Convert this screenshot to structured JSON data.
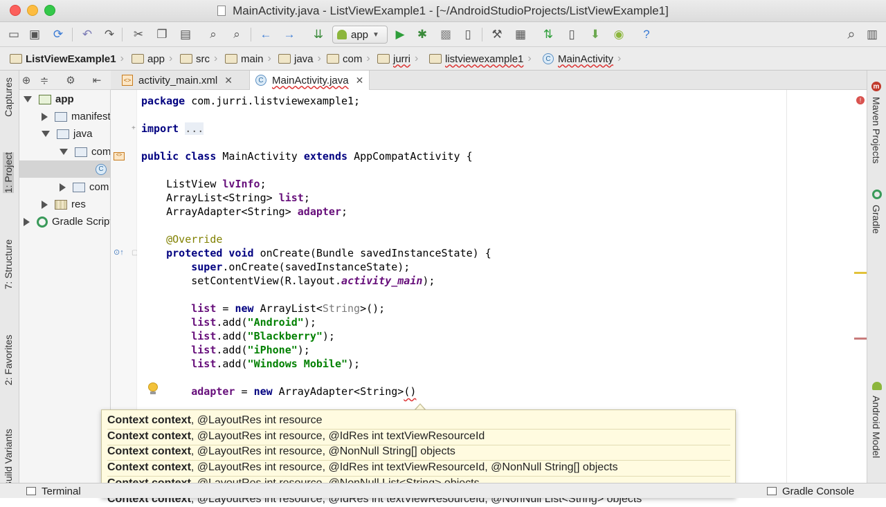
{
  "window": {
    "title": "MainActivity.java - ListViewExample1 - [~/AndroidStudioProjects/ListViewExample1]"
  },
  "toolbar": {
    "run_config": "app",
    "icons": [
      "open-folder",
      "save",
      "sync",
      "undo",
      "redo",
      "cut",
      "copy",
      "paste",
      "find",
      "replace",
      "back",
      "forward",
      "make",
      "run",
      "debug",
      "attach",
      "apply-changes",
      "avd-manager",
      "sdk-manager",
      "sync-gradle",
      "project-structure",
      "android-device-monitor",
      "android",
      "help",
      "search"
    ]
  },
  "breadcrumbs": [
    "ListViewExample1",
    "app",
    "src",
    "main",
    "java",
    "com",
    "jurri",
    "listviewexample1",
    "MainActivity"
  ],
  "left_tool_windows": [
    "Captures",
    "1: Project",
    "7: Structure",
    "2: Favorites",
    "Build Variants"
  ],
  "right_tool_windows": [
    "Maven Projects",
    "Gradle",
    "Android Model"
  ],
  "project_tree": [
    {
      "label": "app",
      "indent": 0
    },
    {
      "label": "manifests",
      "indent": 1
    },
    {
      "label": "java",
      "indent": 1
    },
    {
      "label": "com",
      "indent": 2
    },
    {
      "label": "",
      "indent": 3
    },
    {
      "label": "com",
      "indent": 2
    },
    {
      "label": "res",
      "indent": 1
    },
    {
      "label": "Gradle Scripts",
      "indent": 0
    }
  ],
  "tabs": [
    {
      "label": "activity_main.xml",
      "active": false
    },
    {
      "label": "MainActivity.java",
      "active": true
    }
  ],
  "code": {
    "package_line": "com.jurri.listviewexample1;",
    "import_fold": "...",
    "class_name": "MainActivity",
    "superclass": "AppCompatActivity",
    "listview_field": "lvInfo",
    "list_field": "list",
    "adapter_field": "adapter",
    "annotation": "@Override",
    "method_name": "onCreate",
    "param": "Bundle savedInstanceState",
    "layout_ref": "activity_main",
    "items": [
      "Android",
      "Blackberry",
      "iPhone",
      "Windows Mobile"
    ]
  },
  "param_popup": [
    {
      "bold": "Context context",
      "rest": ", @LayoutRes int resource"
    },
    {
      "bold": "Context context",
      "rest": ", @LayoutRes int resource, @IdRes int textViewResourceId"
    },
    {
      "bold": "Context context",
      "rest": ", @LayoutRes int resource, @NonNull String[] objects"
    },
    {
      "bold": "Context context",
      "rest": ", @LayoutRes int resource, @IdRes int textViewResourceId, @NonNull String[] objects"
    },
    {
      "bold": "Context context",
      "rest": ", @LayoutRes int resource, @NonNull List<String> objects"
    },
    {
      "bold": "Context context",
      "rest": ", @LayoutRes int resource, @IdRes int textViewResourceId, @NonNull List<String> objects"
    }
  ],
  "statusbar": {
    "terminal": "Terminal",
    "gradle_console": "Gradle Console"
  },
  "colors": {
    "keyword": "#000080",
    "field": "#660e7a",
    "string": "#008000",
    "annotation": "#808000",
    "popup_bg": "#fffbe0"
  }
}
